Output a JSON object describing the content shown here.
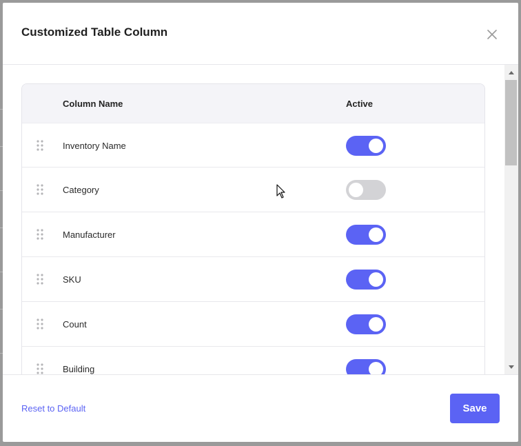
{
  "modal": {
    "title": "Customized Table Column",
    "close_icon": "close-icon"
  },
  "table": {
    "headers": {
      "name": "Column Name",
      "active": "Active"
    },
    "rows": [
      {
        "name": "Inventory Name",
        "active": true
      },
      {
        "name": "Category",
        "active": false
      },
      {
        "name": "Manufacturer",
        "active": true
      },
      {
        "name": "SKU",
        "active": true
      },
      {
        "name": "Count",
        "active": true
      },
      {
        "name": "Building",
        "active": true
      }
    ]
  },
  "footer": {
    "reset_label": "Reset to Default",
    "save_label": "Save"
  },
  "colors": {
    "accent": "#5b63f4",
    "toggle_off": "#d3d3d6"
  }
}
